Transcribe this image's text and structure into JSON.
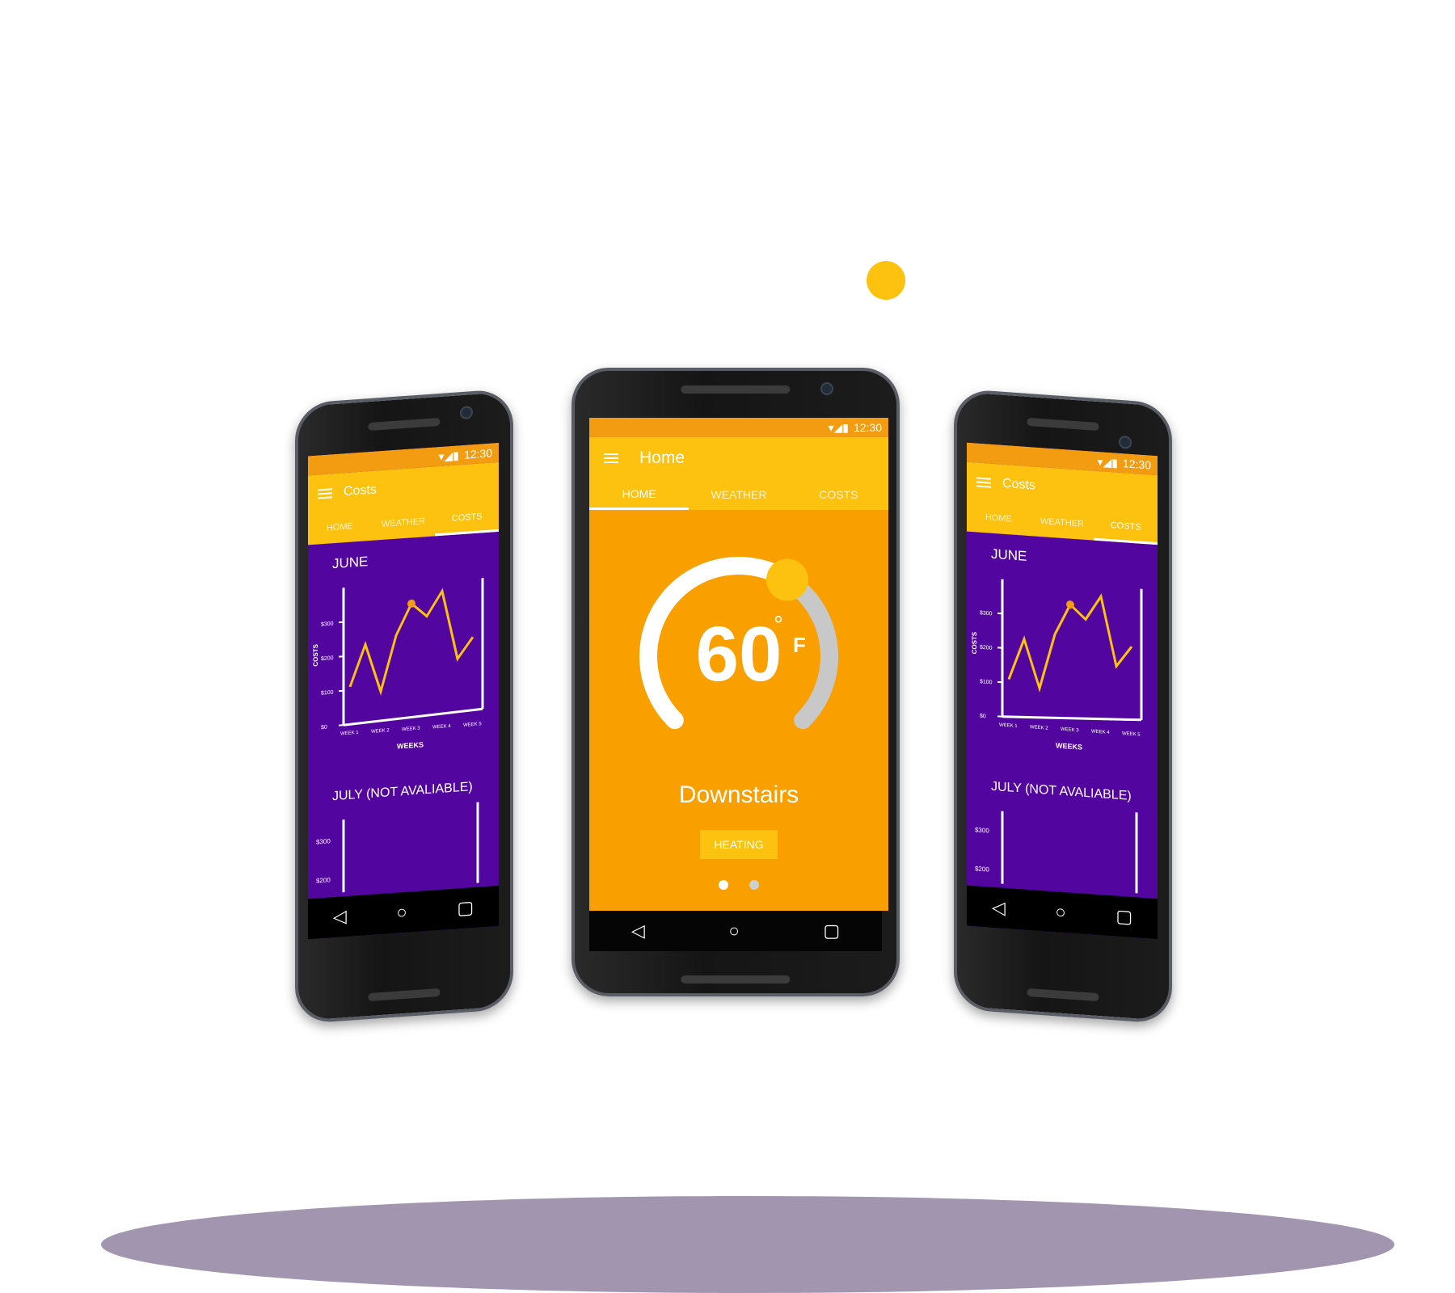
{
  "status": {
    "time": "12:30"
  },
  "home_screen": {
    "app_title": "Home",
    "tabs": [
      "HOME",
      "WEATHER",
      "COSTS"
    ],
    "active_tab": "HOME",
    "temperature": "60",
    "unit_symbol": "°",
    "unit_letter": "F",
    "room_name": "Downstairs",
    "mode_button": "HEATING",
    "dial_fraction": 0.62,
    "page_count": 2,
    "current_page": 1
  },
  "costs_screen": {
    "app_title": "Costs",
    "tabs": [
      "HOME",
      "WEATHER",
      "COSTS"
    ],
    "active_tab": "COSTS",
    "month_1": "JUNE",
    "month_2": "JULY (NOT AVALIABLE)",
    "y_axis_label": "COSTS",
    "x_axis_label": "WEEKS",
    "month_2_ticks": [
      "$300",
      "$200"
    ]
  },
  "chart_data": {
    "type": "line",
    "title": "JUNE",
    "xlabel": "WEEKS",
    "ylabel": "COSTS",
    "categories": [
      "WEEK 1",
      "WEEK 2",
      "WEEK 3",
      "WEEK 4",
      "WEEK 5"
    ],
    "y_ticks": [
      "$0",
      "$100",
      "$200",
      "$300"
    ],
    "ylim": [
      0,
      400
    ],
    "x": [
      1.0,
      1.5,
      2.0,
      2.5,
      3.0,
      3.5,
      4.0,
      4.5,
      5.0
    ],
    "values": [
      110,
      230,
      90,
      250,
      340,
      300,
      370,
      170,
      230
    ],
    "highlight_index": 4,
    "colors": {
      "line": "#fdc10f",
      "axes": "#ffffff",
      "background": "#53069f"
    }
  },
  "colors": {
    "amber": "#f9a000",
    "yellow": "#fdc10f",
    "purple": "#53069f",
    "shadow": "#a295b0"
  }
}
